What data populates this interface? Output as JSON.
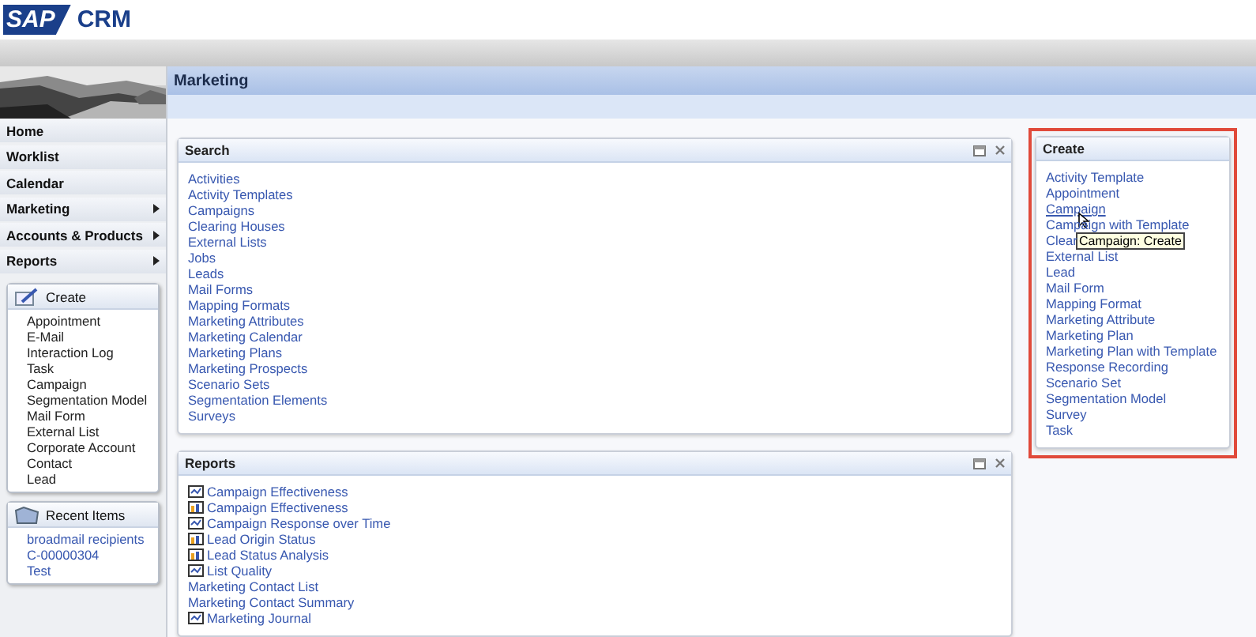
{
  "logo": {
    "brand": "SAP",
    "product": "CRM"
  },
  "nav": [
    {
      "label": "Home",
      "submenu": false
    },
    {
      "label": "Worklist",
      "submenu": false
    },
    {
      "label": "Calendar",
      "submenu": false
    },
    {
      "label": "Marketing",
      "submenu": true
    },
    {
      "label": "Accounts & Products",
      "submenu": true
    },
    {
      "label": "Reports",
      "submenu": true
    }
  ],
  "create_box": {
    "title": "Create",
    "items": [
      "Appointment",
      "E-Mail",
      "Interaction Log",
      "Task",
      "Campaign",
      "Segmentation Model",
      "Mail Form",
      "External List",
      "Corporate Account",
      "Contact",
      "Lead"
    ]
  },
  "recent_items": {
    "title": "Recent Items",
    "items": [
      "broadmail recipients",
      "C-00000304",
      "Test"
    ]
  },
  "page_title": "Marketing",
  "search_panel": {
    "title": "Search",
    "links": [
      "Activities",
      "Activity Templates",
      "Campaigns",
      "Clearing Houses",
      "External Lists",
      "Jobs",
      "Leads",
      "Mail Forms",
      "Mapping Formats",
      "Marketing Attributes",
      "Marketing Calendar",
      "Marketing Plans",
      "Marketing Prospects",
      "Scenario Sets",
      "Segmentation Elements",
      "Surveys"
    ]
  },
  "reports_panel": {
    "title": "Reports",
    "links": [
      {
        "label": "Campaign Effectiveness",
        "kind": "line"
      },
      {
        "label": "Campaign Effectiveness",
        "kind": "bar"
      },
      {
        "label": "Campaign Response over Time",
        "kind": "line"
      },
      {
        "label": "Lead Origin Status",
        "kind": "bar"
      },
      {
        "label": "Lead Status Analysis",
        "kind": "bar"
      },
      {
        "label": "List Quality",
        "kind": "line"
      },
      {
        "label": "Marketing Contact List",
        "kind": "plain"
      },
      {
        "label": "Marketing Contact Summary",
        "kind": "plain"
      },
      {
        "label": "Marketing Journal",
        "kind": "line"
      }
    ]
  },
  "create_panel": {
    "title": "Create",
    "links": [
      {
        "label": "Activity Template",
        "hovered": false
      },
      {
        "label": "Appointment",
        "hovered": false
      },
      {
        "label": "Campaign",
        "hovered": true
      },
      {
        "label": "Campaign with Template",
        "hovered": false
      },
      {
        "label": "Clear",
        "hovered": false
      },
      {
        "label": "External List",
        "hovered": false
      },
      {
        "label": "Lead",
        "hovered": false
      },
      {
        "label": "Mail Form",
        "hovered": false
      },
      {
        "label": "Mapping Format",
        "hovered": false
      },
      {
        "label": "Marketing Attribute",
        "hovered": false
      },
      {
        "label": "Marketing Plan",
        "hovered": false
      },
      {
        "label": "Marketing Plan with Template",
        "hovered": false
      },
      {
        "label": "Response Recording",
        "hovered": false
      },
      {
        "label": "Scenario Set",
        "hovered": false
      },
      {
        "label": "Segmentation Model",
        "hovered": false
      },
      {
        "label": "Survey",
        "hovered": false
      },
      {
        "label": "Task",
        "hovered": false
      }
    ],
    "tooltip": "Campaign: Create"
  }
}
